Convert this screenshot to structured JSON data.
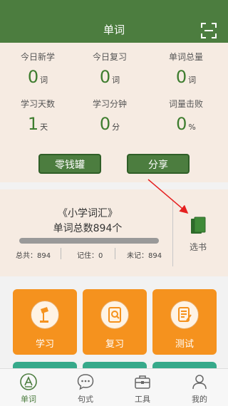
{
  "header": {
    "title": "单词",
    "scan_icon": "scan-icon"
  },
  "stats": [
    {
      "label": "今日新学",
      "value": "0",
      "unit": "词"
    },
    {
      "label": "今日复习",
      "value": "0",
      "unit": "词"
    },
    {
      "label": "单词总量",
      "value": "0",
      "unit": "词"
    },
    {
      "label": "学习天数",
      "value": "1",
      "unit": "天"
    },
    {
      "label": "学习分钟",
      "value": "0",
      "unit": "分"
    },
    {
      "label": "词量击败",
      "value": "0",
      "unit": "%"
    }
  ],
  "buttons": {
    "piggy_bank": "零钱罐",
    "share": "分享"
  },
  "book": {
    "name": "《小学词汇》",
    "total": "单词总数894个",
    "progress": 0,
    "total_label": "总共：894",
    "remembered_label": "记住：0",
    "unremembered_label": "未记：894",
    "select_label": "选书"
  },
  "tiles": [
    {
      "label": "学习",
      "icon": "lamp-icon"
    },
    {
      "label": "复习",
      "icon": "search-doc-icon"
    },
    {
      "label": "测试",
      "icon": "test-doc-icon"
    }
  ],
  "tabs": [
    {
      "label": "单词",
      "icon": "word-icon",
      "active": true
    },
    {
      "label": "句式",
      "icon": "chat-icon",
      "active": false
    },
    {
      "label": "工具",
      "icon": "toolbox-icon",
      "active": false
    },
    {
      "label": "我的",
      "icon": "person-icon",
      "active": false
    }
  ],
  "colors": {
    "primary": "#4c7d3f",
    "orange": "#f5921e",
    "teal": "#36a98a",
    "cream": "#f6ebe2",
    "arrow": "#e52020"
  }
}
